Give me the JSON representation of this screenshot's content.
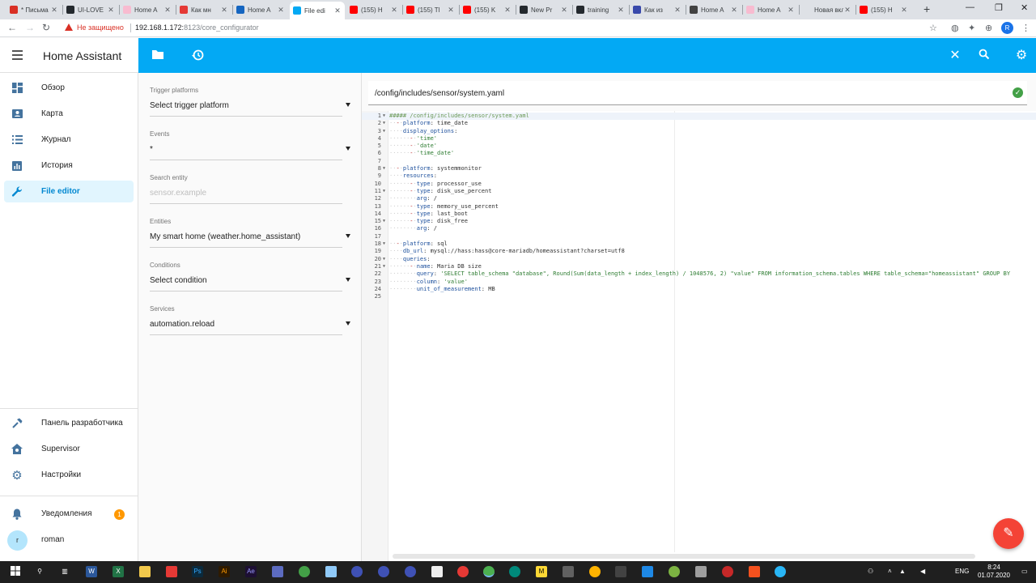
{
  "browser": {
    "tabs": [
      {
        "label": "* Письма",
        "color": "#d93025"
      },
      {
        "label": "UI-LOVE",
        "color": "#24292e"
      },
      {
        "label": "Home A",
        "color": "#f8bbd0"
      },
      {
        "label": "Как мн",
        "color": "#e53935"
      },
      {
        "label": "Home A",
        "color": "#1565c0"
      },
      {
        "label": "File edi",
        "color": "#03a9f4",
        "active": true
      },
      {
        "label": "(155) H",
        "color": "#ff0000"
      },
      {
        "label": "(155) Tl",
        "color": "#ff0000"
      },
      {
        "label": "(155) K",
        "color": "#ff0000"
      },
      {
        "label": "New Pr",
        "color": "#24292e"
      },
      {
        "label": "training",
        "color": "#24292e"
      },
      {
        "label": "Как из",
        "color": "#3949ab"
      },
      {
        "label": "Home A",
        "color": "#424242"
      },
      {
        "label": "Home A",
        "color": "#f8bbd0"
      },
      {
        "label": "Новая вкла",
        "color": "#dee1e6"
      },
      {
        "label": "(155) H",
        "color": "#ff0000"
      }
    ],
    "new_tab": "+",
    "insecure_label": "Не защищено",
    "url_host": "192.168.1.172:",
    "url_path": "8123/core_configurator",
    "profile_initial": "R"
  },
  "app": {
    "title": "Home Assistant"
  },
  "sidebar": {
    "items": [
      {
        "label": "Обзор",
        "icon": "dashboard-icon"
      },
      {
        "label": "Карта",
        "icon": "map-icon"
      },
      {
        "label": "Журнал",
        "icon": "list-icon"
      },
      {
        "label": "История",
        "icon": "chart-icon"
      },
      {
        "label": "File editor",
        "icon": "wrench-icon",
        "active": true
      }
    ],
    "bottom_items": [
      {
        "label": "Панель разработчика",
        "icon": "hammer-icon"
      },
      {
        "label": "Supervisor",
        "icon": "supervisor-icon"
      },
      {
        "label": "Настройки",
        "icon": "gear-icon"
      }
    ],
    "notifications": {
      "label": "Уведомления",
      "count": "1"
    },
    "user": {
      "initial": "r",
      "name": "roman"
    }
  },
  "form": {
    "trigger_platforms": {
      "label": "Trigger platforms",
      "value": "Select trigger platform"
    },
    "events": {
      "label": "Events",
      "value": "*"
    },
    "search_entity": {
      "label": "Search entity",
      "placeholder": "sensor.example"
    },
    "entities": {
      "label": "Entities",
      "value": "My smart home (weather.home_assistant)"
    },
    "conditions": {
      "label": "Conditions",
      "value": "Select condition"
    },
    "services": {
      "label": "Services",
      "value": "automation.reload"
    }
  },
  "editor": {
    "file_path": "/config/includes/sensor/system.yaml",
    "lines": [
      "##### /config/includes/sensor/system.yaml",
      "  - platform: time_date",
      "    display_options:",
      "      - 'time'",
      "      - 'date'",
      "      - 'time_date'",
      "",
      "  - platform: systemmonitor",
      "    resources:",
      "      - type: processor_use",
      "      - type: disk_use_percent",
      "        arg: /",
      "      - type: memory_use_percent",
      "      - type: last_boot",
      "      - type: disk_free",
      "        arg: /",
      "",
      "  - platform: sql",
      "    db_url: mysql://hass:hass@core-mariadb/homeassistant?charset=utf8",
      "    queries:",
      "      - name: Maria DB size",
      "        query: 'SELECT table_schema \"database\", Round(Sum(data_length + index_length) / 1048576, 2) \"value\" FROM information_schema.tables WHERE table_schema=\"homeassistant\" GROUP BY",
      "        column: 'value'",
      "        unit_of_measurement: MB",
      ""
    ],
    "fold_lines": [
      1,
      2,
      3,
      8,
      11,
      15,
      18,
      20,
      21
    ]
  },
  "taskbar": {
    "lang": "ENG",
    "time": "8:24",
    "date": "01.07.2020"
  }
}
